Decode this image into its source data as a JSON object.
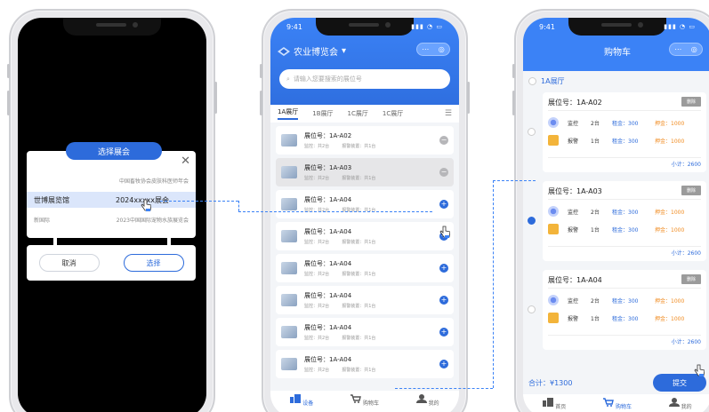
{
  "phone1": {
    "modal_title": "选择展会",
    "close_icon": "close-icon",
    "rows": [
      {
        "left": "",
        "right": "中国畜牧协会皮肤科医师年会"
      },
      {
        "left": "世博展览馆",
        "right": "2024xxxxx展会"
      },
      {
        "left": "新国际",
        "right": "2023中国国际宠物水族展览会"
      }
    ],
    "cancel_label": "取消",
    "confirm_label": "选择"
  },
  "phone2": {
    "time": "9:41",
    "title": "农业博览会",
    "search_placeholder": "请输入您要搜索的展位号",
    "tabs": [
      "1A展厅",
      "1B展厅",
      "1C展厅",
      "1C展厅"
    ],
    "cards": [
      {
        "title": "展位号：1A-A02",
        "mon": "监控：共2台",
        "alarm": "报警装置：共1台",
        "btn": "−",
        "grey": false
      },
      {
        "title": "展位号：1A-A03",
        "mon": "监控：共2台",
        "alarm": "报警装置：共1台",
        "btn": "−",
        "grey": true
      },
      {
        "title": "展位号：1A-A04",
        "mon": "监控：共2台",
        "alarm": "报警装置：共1台",
        "btn": "+",
        "grey": false
      },
      {
        "title": "展位号：1A-A04",
        "mon": "监控：共2台",
        "alarm": "报警装置：共1台",
        "btn": "+",
        "grey": false
      },
      {
        "title": "展位号：1A-A04",
        "mon": "监控：共2台",
        "alarm": "报警装置：共1台",
        "btn": "+",
        "grey": false
      },
      {
        "title": "展位号：1A-A04",
        "mon": "监控：共2台",
        "alarm": "报警装置：共1台",
        "btn": "+",
        "grey": false
      },
      {
        "title": "展位号：1A-A04",
        "mon": "监控：共2台",
        "alarm": "报警装置：共1台",
        "btn": "+",
        "grey": false
      },
      {
        "title": "展位号：1A-A04",
        "mon": "监控：共2台",
        "alarm": "报警装置：共1台",
        "btn": "+",
        "grey": false
      }
    ],
    "tabbar": [
      "设备",
      "购物车",
      "我的"
    ]
  },
  "phone3": {
    "time": "9:41",
    "title": "购物车",
    "hall": "1A展厅",
    "delete_label": "删除",
    "cards": [
      {
        "title": "展位号：1A-A02",
        "checked": false
      },
      {
        "title": "展位号：1A-A03",
        "checked": true
      },
      {
        "title": "展位号：1A-A04",
        "checked": false
      }
    ],
    "items": [
      {
        "name": "监控",
        "qty": "2台",
        "rent": "租金：300",
        "deposit": "押金：1000"
      },
      {
        "name": "报警",
        "qty": "1台",
        "rent": "租金：300",
        "deposit": "押金：1000"
      }
    ],
    "subtotal": "小计：2600",
    "total": "合计：¥1300",
    "submit_label": "提交",
    "tabbar": [
      "首页",
      "购物车",
      "我的"
    ]
  },
  "colors": {
    "primary": "#2d6bdb",
    "header": "#3b82f6",
    "deposit": "#f08a1e"
  }
}
